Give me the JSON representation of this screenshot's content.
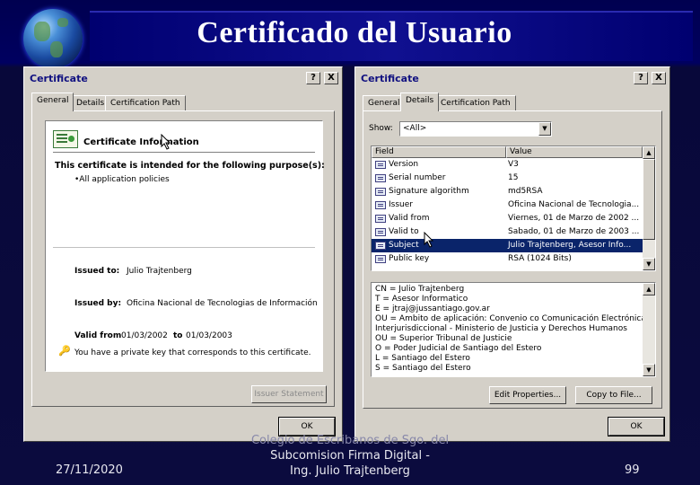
{
  "slide": {
    "title": "Certificado del Usuario",
    "date": "27/11/2020",
    "page_number": "99",
    "footer_lines": [
      "Colegio de Escribanos de Sgo. del",
      "Subcomision Firma Digital -",
      "Ing. Julio Trajtenberg"
    ]
  },
  "dialog_general": {
    "title": "Certificate",
    "help_btn": "?",
    "close_btn": "X",
    "tabs": [
      "General",
      "Details",
      "Certification Path"
    ],
    "active_tab": "General",
    "info_heading": "Certificate Information",
    "purpose_heading": "This certificate is intended for the following purpose(s):",
    "purpose_item": "•All application policies",
    "issued_to_label": "Issued to:",
    "issued_to_value": "Julio Trajtenberg",
    "issued_by_label": "Issued by:",
    "issued_by_value": "Oficina Nacional de Tecnologias de Información",
    "valid_from_label": "Valid from",
    "valid_from_value": "01/03/2002",
    "valid_to_label": "to",
    "valid_to_value": "01/03/2003",
    "private_key_note": "You have a private key that corresponds to this certificate.",
    "issuer_statement_btn": "Issuer Statement",
    "ok_btn": "OK"
  },
  "dialog_details": {
    "title": "Certificate",
    "help_btn": "?",
    "close_btn": "X",
    "tabs": [
      "General",
      "Details",
      "Certification Path"
    ],
    "active_tab": "Details",
    "show_label": "Show:",
    "show_value": "<All>",
    "columns": [
      "Field",
      "Value"
    ],
    "rows": [
      {
        "field": "Version",
        "value": "V3"
      },
      {
        "field": "Serial number",
        "value": "15"
      },
      {
        "field": "Signature algorithm",
        "value": "md5RSA"
      },
      {
        "field": "Issuer",
        "value": "Oficina Nacional de Tecnologia..."
      },
      {
        "field": "Valid from",
        "value": "Viernes, 01 de Marzo de 2002 ..."
      },
      {
        "field": "Valid to",
        "value": "Sabado, 01 de Marzo de 2003 ..."
      },
      {
        "field": "Subject",
        "value": "Julio Trajtenberg, Asesor Info..."
      },
      {
        "field": "Public key",
        "value": "RSA (1024 Bits)"
      }
    ],
    "selected_row": "Subject",
    "detail_lines": [
      "CN = Julio Trajtenberg",
      "T = Asesor Informatico",
      "E = jtraj@jussantiago.gov.ar",
      "OU = Ambito de aplicación: Convenio co Comunicación Electrónica",
      "Interjurisdiccional - Ministerio de Justicia y Derechos Humanos",
      "OU = Superior Tribunal de Justicie",
      "O = Poder Judicial de Santiago del Estero",
      "L = Santiago del Estero",
      "S = Santiago del Estero"
    ],
    "edit_properties_btn": "Edit Properties...",
    "copy_to_file_btn": "Copy to File...",
    "ok_btn": "OK"
  },
  "colors": {
    "slide_background": "#0a0a3a",
    "title_text": "#ffffff",
    "dialog_face": "#d4d0c8",
    "selection": "#0a246a",
    "titlebar_text": "#101080"
  },
  "icons": [
    "globe-icon",
    "certificate-icon",
    "key-icon",
    "mouse-cursor-icon",
    "field-icon",
    "dropdown-arrow-icon",
    "scroll-up-icon",
    "scroll-down-icon"
  ]
}
